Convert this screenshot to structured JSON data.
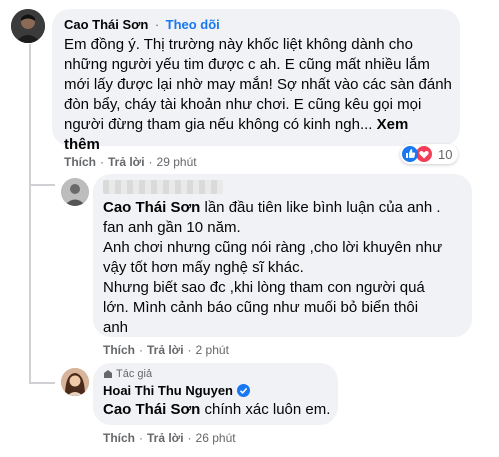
{
  "comment1": {
    "author": "Cao Thái Sơn",
    "dot": "·",
    "follow": "Theo dõi",
    "lines": [
      "Em đồng ý. Thị trường này khốc liệt không dành cho",
      "những người yếu tim được c ah. E cũng mất nhiều lắm",
      "mới lấy được lại nhờ may mắn! Sợ nhất vào các sàn đánh",
      "đòn bẩy, cháy tài khoản như chơi. E cũng kêu gọi mọi",
      "người đừng tham gia nếu không có kinh ngh..."
    ],
    "see_more_1": "Xem",
    "see_more_2": "thêm",
    "like": "Thích",
    "reply": "Trả lời",
    "time": "29 phút",
    "reaction_count": "10"
  },
  "comment2": {
    "mention": "Cao Thái Sơn",
    "line1_rest": " lần đầu tiên like bình luận của anh .",
    "lines": [
      "fan anh gần 10 năm.",
      "Anh chơi nhưng cũng nói ràng ,cho lời khuyên như",
      "vậy tốt hơn mấy nghệ sĩ khác.",
      "Nhưng biết sao đc ,khi lòng tham con người quá",
      "lớn. Mình cảnh báo cũng như muối bỏ biển thôi",
      "anh"
    ],
    "like": "Thích",
    "reply": "Trả lời",
    "time": "2 phút"
  },
  "comment3": {
    "badge": "Tác giả",
    "author": "Hoai Thi Thu Nguyen",
    "mention": "Cao Thái Sơn",
    "text_rest": " chính xác luôn em.",
    "like": "Thích",
    "reply": "Trả lời",
    "time": "26 phút"
  },
  "colors": {
    "bubble": "#f0f2f5",
    "secondary_text": "#65676b",
    "link_blue": "#1877f2",
    "verified_blue": "#1877f2"
  },
  "icons": [
    "author-avatar",
    "like-reaction-icon",
    "love-reaction-icon",
    "verified-badge-icon",
    "author-badge-icon"
  ]
}
